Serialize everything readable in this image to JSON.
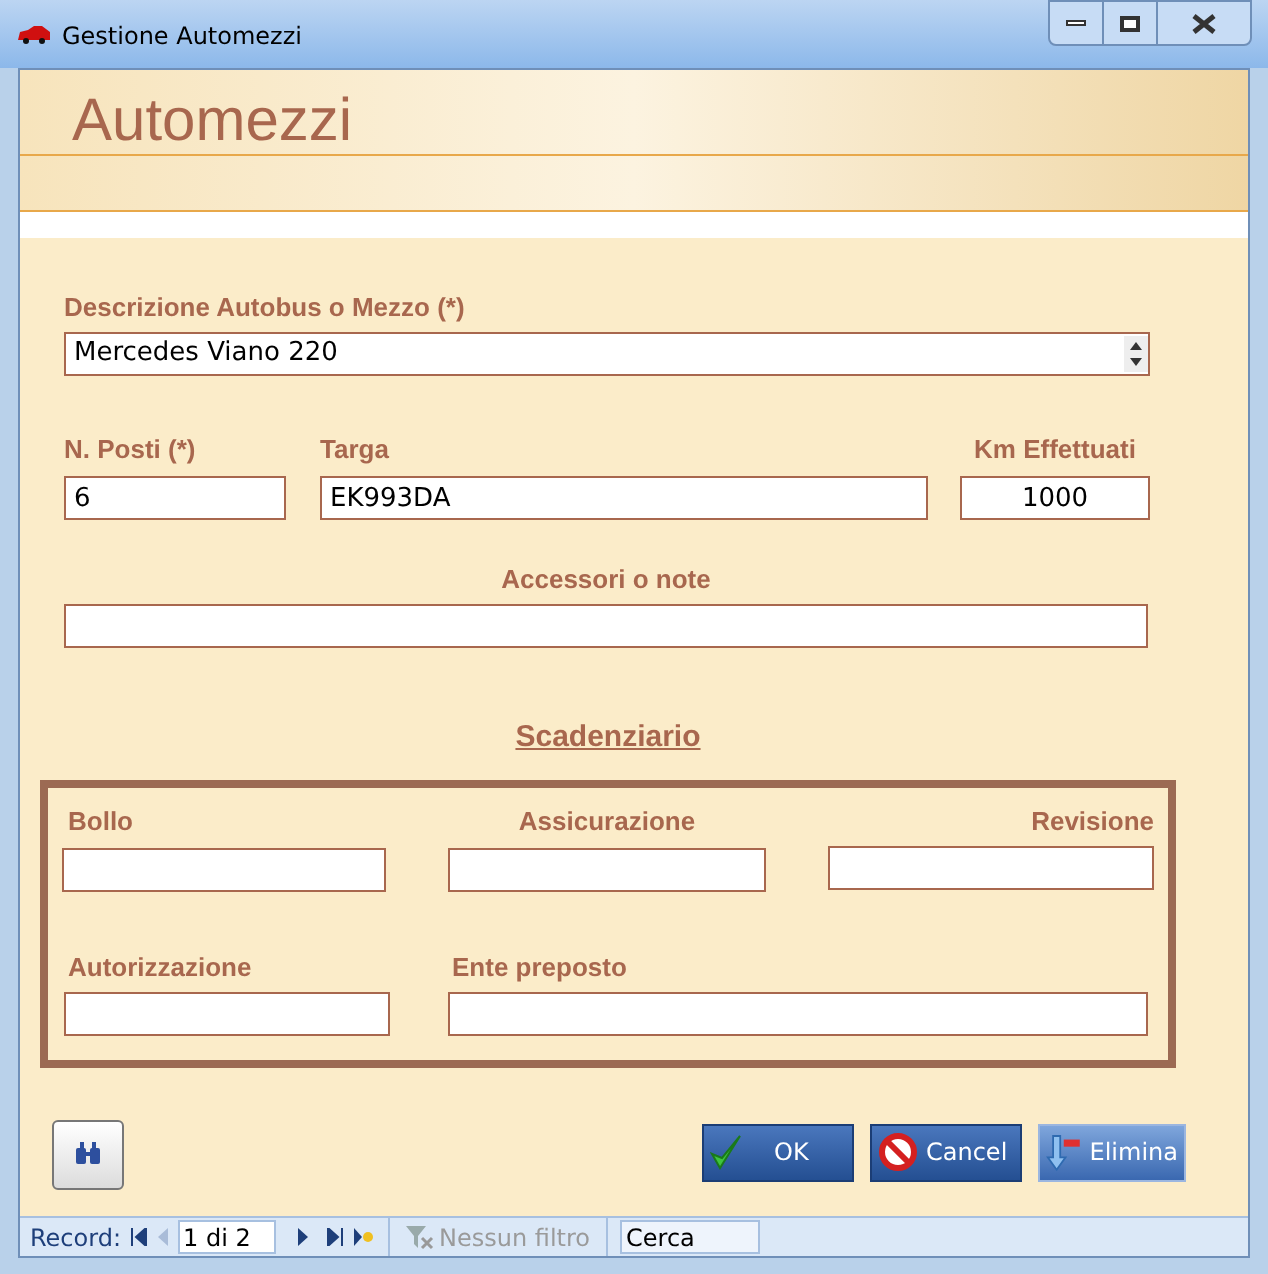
{
  "window": {
    "title": "Gestione Automezzi"
  },
  "header": {
    "title": "Automezzi"
  },
  "description": {
    "label": "Descrizione Autobus o Mezzo (*)",
    "value": "Mercedes Viano 220"
  },
  "seats": {
    "label": "N. Posti (*)",
    "value": "6"
  },
  "plate": {
    "label": "Targa",
    "value": "EK993DA"
  },
  "km": {
    "label": "Km Effettuati",
    "value": "1000"
  },
  "notes": {
    "label": "Accessori o note"
  },
  "schedule": {
    "title": "Scadenziario",
    "fields": [
      {
        "label": "Bollo"
      },
      {
        "label": "Assicurazione"
      },
      {
        "label": "Revisione"
      },
      {
        "label": "Autorizzazione"
      },
      {
        "label": "Ente preposto"
      }
    ]
  },
  "buttons": [
    {
      "label": "OK",
      "kind": "ok"
    },
    {
      "label": "Cancel",
      "kind": "cancel"
    },
    {
      "label": "Elimina",
      "kind": "delete"
    }
  ],
  "status_bar": {
    "label": "Record:",
    "position": "1 di 2",
    "filter": "Nessun filtro",
    "search": "Cerca"
  }
}
